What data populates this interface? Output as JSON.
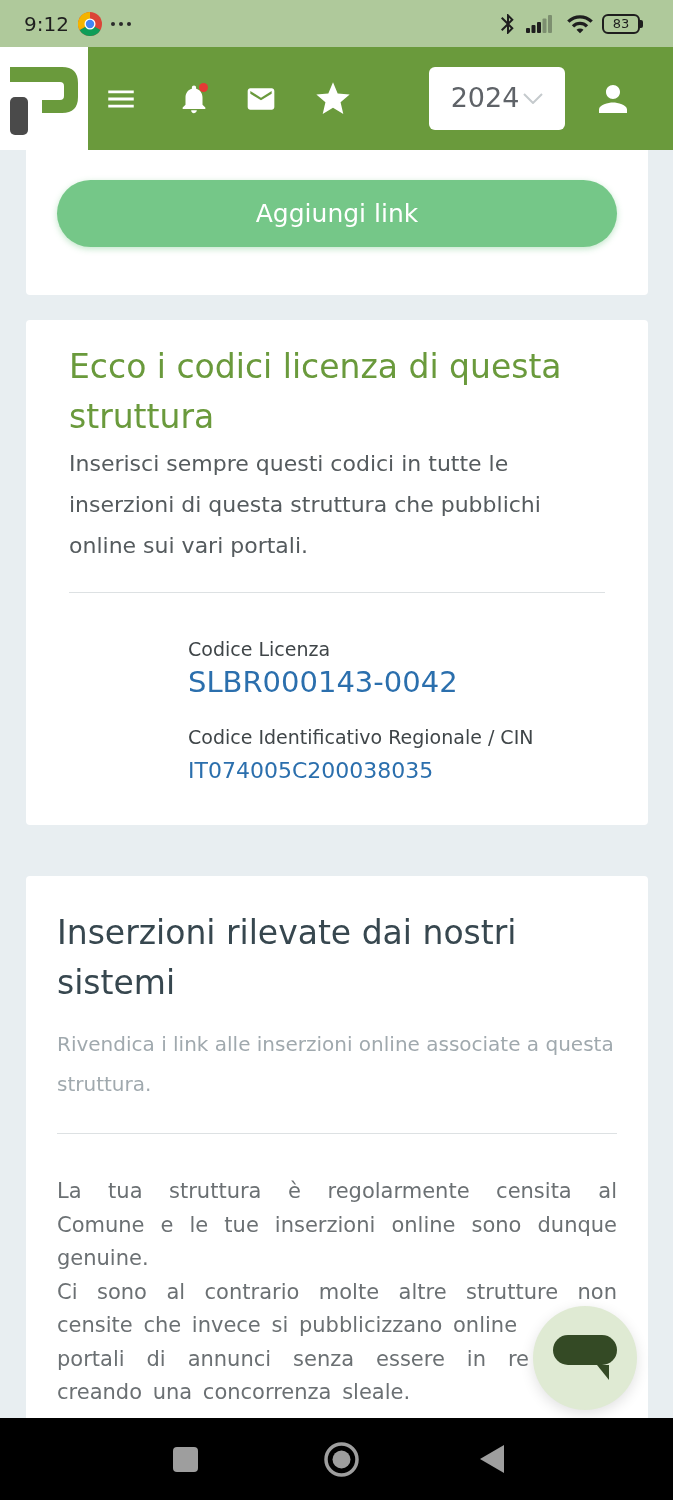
{
  "status_bar": {
    "time": "9:12",
    "battery": "83"
  },
  "header": {
    "notifications": {
      "unread": true
    },
    "year_select": {
      "value": "2024"
    }
  },
  "link_card": {
    "button": "Aggiungi link"
  },
  "license_card": {
    "title": "Ecco i codici licenza di questa struttura",
    "description": "Inserisci sempre questi codici in tutte le inserzioni di questa struttura che pubblichi online sui vari portali.",
    "codes": [
      {
        "kind": "primary",
        "label": "Codice Licenza",
        "value": "SLBR000143-0042"
      },
      {
        "kind": "secondary",
        "label": "Codice Identificativo Regionale / CIN",
        "value": "IT074005C200038035"
      }
    ]
  },
  "listings_card": {
    "title": "Inserzioni rilevate dai nostri sistemi",
    "subtitle": "Rivendica i link alle inserzioni online associate a questa struttura.",
    "paragraph": "La tua struttura è regolarmente censita al Comune e le tue inserzioni online sono dunque genuine.",
    "covered_lines": [
      {
        "kind": "full",
        "text": "Ci sono al contrario molte altre strutture non"
      },
      {
        "kind": "clipped",
        "text": "censite che invece si pubblicizzano online"
      },
      {
        "kind": "spread",
        "text": "portali di annunci senza essere in re"
      },
      {
        "kind": "last",
        "text": "creando una concorrenza sleale."
      }
    ]
  }
}
